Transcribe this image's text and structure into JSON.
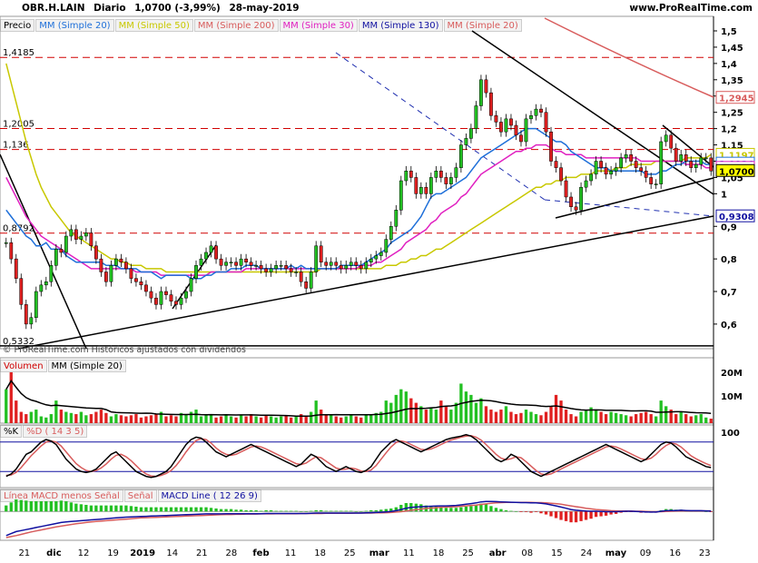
{
  "header": {
    "symbol": "OBR.H.LAIN",
    "period": "Diario",
    "last": "1,0700 (-3,99%)",
    "date": "28-may-2019",
    "site": "www.ProRealTime.com"
  },
  "price_legend": [
    {
      "label": "Precio",
      "color": "#000000"
    },
    {
      "label": "MM (Simple 20)",
      "color": "#1e6fd9"
    },
    {
      "label": "MM (Simple 50)",
      "color": "#c8c800"
    },
    {
      "label": "MM (Simple 200)",
      "color": "#d85c5c"
    },
    {
      "label": "MM (Simple 30)",
      "color": "#e020c0"
    },
    {
      "label": "MM (Simple 130)",
      "color": "#1010a0"
    },
    {
      "label": "MM (Simple 20)",
      "color": "#d85c5c"
    }
  ],
  "copyright": "© ProRealTime.com Históricos ajustados con dividendos",
  "volume_legend": [
    {
      "label": "Volumen",
      "color": "#d00000"
    },
    {
      "label": "MM (Simple 20)",
      "color": "#000000"
    }
  ],
  "stoch_legend": [
    {
      "label": "%K",
      "color": "#000000"
    },
    {
      "label": "%D ( 14 3 5)",
      "color": "#d85c5c"
    }
  ],
  "macd_legend": [
    {
      "label": "Línea MACD menos Señal",
      "color": "#d85c5c"
    },
    {
      "label": "Señal",
      "color": "#d85c5c"
    },
    {
      "label": "MACD Line ( 12 26 9)",
      "color": "#1010a0"
    }
  ],
  "hlines": [
    {
      "label": "1,4185",
      "value": 1.4185
    },
    {
      "label": "1,2005",
      "value": 1.2005
    },
    {
      "label": "1,136",
      "value": 1.136
    },
    {
      "label": "0,8792",
      "value": 0.8792
    },
    {
      "label": "0,5332",
      "value": 0.5332
    }
  ],
  "chart_data": {
    "type": "candlestick",
    "y_axis": {
      "min": 0.53,
      "max": 1.5,
      "ticks": [
        "1,5",
        "1,45",
        "1,4",
        "1,35",
        "1,3",
        "1,25",
        "1,2",
        "1,15",
        "1,1",
        "1,05",
        "1",
        "0,9",
        "0,8",
        "0,7",
        "0,6"
      ],
      "tick_values": [
        1.5,
        1.45,
        1.4,
        1.35,
        1.3,
        1.25,
        1.2,
        1.15,
        1.1,
        1.05,
        1.0,
        0.9,
        0.8,
        0.7,
        0.6
      ]
    },
    "x_labels": [
      "21",
      "dic",
      "12",
      "19",
      "2019",
      "14",
      "21",
      "28",
      "feb",
      "11",
      "18",
      "25",
      "mar",
      "11",
      "18",
      "25",
      "abr",
      "08",
      "15",
      "24",
      "may",
      "09",
      "16",
      "23"
    ],
    "value_tags": [
      {
        "label": "1,2945",
        "value": 1.2945,
        "color": "#d85c5c"
      },
      {
        "label": "1,1197",
        "value": 1.1197,
        "color": "#c8c800"
      },
      {
        "label": "1,0926",
        "value": 1.0926,
        "color": "#1e6fd9"
      },
      {
        "label": "1,0796",
        "value": 1.0796,
        "color": "#e020c0"
      },
      {
        "label": "1,0700",
        "value": 1.07,
        "color": "#000000"
      },
      {
        "label": "0,9308",
        "value": 0.9308,
        "color": "#1010a0"
      }
    ],
    "close": [
      0.85,
      0.8,
      0.74,
      0.66,
      0.6,
      0.62,
      0.7,
      0.72,
      0.73,
      0.78,
      0.83,
      0.82,
      0.87,
      0.89,
      0.86,
      0.87,
      0.88,
      0.84,
      0.8,
      0.76,
      0.73,
      0.78,
      0.8,
      0.79,
      0.77,
      0.74,
      0.73,
      0.72,
      0.7,
      0.68,
      0.66,
      0.7,
      0.69,
      0.67,
      0.66,
      0.68,
      0.7,
      0.74,
      0.78,
      0.8,
      0.82,
      0.84,
      0.8,
      0.78,
      0.79,
      0.79,
      0.78,
      0.8,
      0.79,
      0.78,
      0.78,
      0.77,
      0.76,
      0.77,
      0.78,
      0.78,
      0.77,
      0.76,
      0.76,
      0.73,
      0.71,
      0.76,
      0.84,
      0.79,
      0.78,
      0.79,
      0.78,
      0.77,
      0.78,
      0.79,
      0.78,
      0.77,
      0.79,
      0.8,
      0.81,
      0.82,
      0.86,
      0.9,
      0.95,
      1.04,
      1.07,
      1.05,
      1.0,
      1.02,
      1.0,
      1.05,
      1.07,
      1.05,
      1.03,
      1.05,
      1.08,
      1.15,
      1.17,
      1.2,
      1.27,
      1.35,
      1.31,
      1.24,
      1.22,
      1.19,
      1.23,
      1.21,
      1.18,
      1.16,
      1.23,
      1.24,
      1.26,
      1.25,
      1.19,
      1.1,
      1.08,
      1.04,
      0.99,
      0.96,
      0.95,
      1.02,
      1.04,
      1.06,
      1.1,
      1.08,
      1.06,
      1.07,
      1.08,
      1.11,
      1.12,
      1.1,
      1.08,
      1.07,
      1.05,
      1.03,
      1.03,
      1.16,
      1.18,
      1.14,
      1.1,
      1.12,
      1.1,
      1.08,
      1.09,
      1.11,
      1.11,
      1.07
    ],
    "sma20": [
      0.95,
      0.93,
      0.91,
      0.89,
      0.87,
      0.86,
      0.84,
      0.84,
      0.85,
      0.83,
      0.83,
      0.83,
      0.81,
      0.8,
      0.79,
      0.79,
      0.79,
      0.79,
      0.79,
      0.79,
      0.78,
      0.78,
      0.78,
      0.77,
      0.77,
      0.77,
      0.77,
      0.76,
      0.76,
      0.76,
      0.75,
      0.74,
      0.75,
      0.75,
      0.75,
      0.75,
      0.75,
      0.74,
      0.74,
      0.74,
      0.75,
      0.75,
      0.76,
      0.76,
      0.76,
      0.77,
      0.77,
      0.77,
      0.78,
      0.78,
      0.78,
      0.77,
      0.77,
      0.77,
      0.77,
      0.77,
      0.77,
      0.78,
      0.77,
      0.78,
      0.77,
      0.77,
      0.77,
      0.77,
      0.77,
      0.77,
      0.77,
      0.78,
      0.78,
      0.78,
      0.78,
      0.78,
      0.79,
      0.8,
      0.81,
      0.82,
      0.83,
      0.85,
      0.86,
      0.87,
      0.88,
      0.89,
      0.91,
      0.93,
      0.96,
      0.99,
      1.0,
      1.0,
      1.01,
      1.02,
      1.03,
      1.04,
      1.05,
      1.07,
      1.09,
      1.11,
      1.12,
      1.13,
      1.14,
      1.15,
      1.16,
      1.17,
      1.18,
      1.19,
      1.2,
      1.2,
      1.2,
      1.19,
      1.18,
      1.17,
      1.16,
      1.16,
      1.15,
      1.13,
      1.12,
      1.11,
      1.1,
      1.09,
      1.08,
      1.08,
      1.08,
      1.07,
      1.07,
      1.07,
      1.07,
      1.07,
      1.07,
      1.07,
      1.06,
      1.06,
      1.06,
      1.07,
      1.07,
      1.08,
      1.09,
      1.09,
      1.1,
      1.1,
      1.1,
      1.1,
      1.09,
      1.09
    ],
    "sma30": [
      1.05,
      1.02,
      0.99,
      0.96,
      0.93,
      0.91,
      0.89,
      0.87,
      0.86,
      0.85,
      0.84,
      0.83,
      0.82,
      0.81,
      0.8,
      0.79,
      0.78,
      0.77,
      0.77,
      0.77,
      0.77,
      0.77,
      0.77,
      0.77,
      0.77,
      0.77,
      0.76,
      0.76,
      0.76,
      0.76,
      0.76,
      0.75,
      0.75,
      0.75,
      0.75,
      0.75,
      0.75,
      0.75,
      0.75,
      0.75,
      0.75,
      0.76,
      0.76,
      0.76,
      0.76,
      0.76,
      0.76,
      0.76,
      0.77,
      0.77,
      0.77,
      0.77,
      0.77,
      0.77,
      0.77,
      0.77,
      0.77,
      0.77,
      0.77,
      0.77,
      0.77,
      0.77,
      0.77,
      0.77,
      0.77,
      0.77,
      0.77,
      0.77,
      0.77,
      0.77,
      0.77,
      0.78,
      0.78,
      0.78,
      0.79,
      0.79,
      0.8,
      0.81,
      0.82,
      0.83,
      0.85,
      0.86,
      0.87,
      0.88,
      0.89,
      0.91,
      0.92,
      0.94,
      0.95,
      0.96,
      0.97,
      0.99,
      1.0,
      1.02,
      1.04,
      1.06,
      1.07,
      1.08,
      1.09,
      1.1,
      1.11,
      1.12,
      1.13,
      1.13,
      1.14,
      1.14,
      1.15,
      1.15,
      1.15,
      1.14,
      1.13,
      1.13,
      1.12,
      1.12,
      1.12,
      1.12,
      1.11,
      1.11,
      1.11,
      1.11,
      1.11,
      1.11,
      1.11,
      1.11,
      1.11,
      1.11,
      1.11,
      1.1,
      1.1,
      1.1,
      1.1,
      1.1,
      1.1,
      1.1,
      1.1,
      1.1,
      1.09,
      1.09,
      1.09,
      1.09,
      1.08,
      1.08
    ],
    "sma50": [
      1.4,
      1.34,
      1.28,
      1.22,
      1.16,
      1.11,
      1.06,
      1.02,
      0.99,
      0.96,
      0.94,
      0.92,
      0.9,
      0.88,
      0.87,
      0.86,
      0.85,
      0.84,
      0.83,
      0.82,
      0.81,
      0.8,
      0.8,
      0.79,
      0.79,
      0.78,
      0.78,
      0.78,
      0.77,
      0.77,
      0.77,
      0.77,
      0.76,
      0.76,
      0.76,
      0.76,
      0.76,
      0.76,
      0.76,
      0.76,
      0.76,
      0.76,
      0.76,
      0.76,
      0.76,
      0.76,
      0.76,
      0.76,
      0.76,
      0.76,
      0.76,
      0.76,
      0.76,
      0.76,
      0.76,
      0.76,
      0.76,
      0.76,
      0.76,
      0.76,
      0.76,
      0.76,
      0.76,
      0.77,
      0.77,
      0.77,
      0.77,
      0.77,
      0.77,
      0.77,
      0.77,
      0.77,
      0.77,
      0.77,
      0.77,
      0.77,
      0.78,
      0.78,
      0.78,
      0.79,
      0.79,
      0.8,
      0.8,
      0.81,
      0.81,
      0.82,
      0.83,
      0.83,
      0.84,
      0.85,
      0.86,
      0.87,
      0.88,
      0.89,
      0.9,
      0.91,
      0.92,
      0.93,
      0.94,
      0.95,
      0.96,
      0.97,
      0.98,
      0.99,
      1.0,
      1.01,
      1.02,
      1.02,
      1.03,
      1.03,
      1.04,
      1.04,
      1.05,
      1.05,
      1.05,
      1.06,
      1.06,
      1.06,
      1.07,
      1.07,
      1.07,
      1.07,
      1.08,
      1.08,
      1.08,
      1.09,
      1.09,
      1.09,
      1.09,
      1.09,
      1.1,
      1.1,
      1.1,
      1.1,
      1.1,
      1.1,
      1.11,
      1.11,
      1.11,
      1.11,
      1.11,
      1.12
    ],
    "volume": [
      30,
      45,
      20,
      10,
      8,
      10,
      12,
      6,
      5,
      8,
      20,
      12,
      10,
      9,
      8,
      10,
      7,
      8,
      10,
      12,
      9,
      6,
      8,
      7,
      6,
      7,
      8,
      5,
      6,
      7,
      8,
      10,
      6,
      7,
      6,
      9,
      8,
      10,
      12,
      6,
      8,
      7,
      5,
      6,
      7,
      6,
      5,
      7,
      6,
      8,
      6,
      5,
      7,
      6,
      5,
      6,
      7,
      5,
      6,
      8,
      6,
      10,
      20,
      12,
      8,
      7,
      6,
      5,
      6,
      7,
      6,
      5,
      8,
      7,
      9,
      10,
      20,
      18,
      25,
      30,
      28,
      22,
      18,
      15,
      12,
      14,
      12,
      20,
      15,
      12,
      18,
      35,
      28,
      25,
      18,
      22,
      15,
      12,
      10,
      12,
      15,
      10,
      8,
      9,
      12,
      10,
      8,
      7,
      10,
      15,
      25,
      20,
      12,
      8,
      6,
      10,
      12,
      14,
      12,
      10,
      8,
      10,
      9,
      8,
      7,
      6,
      8,
      9,
      10,
      8,
      6,
      20,
      15,
      12,
      8,
      10,
      8,
      6,
      7,
      8,
      5,
      4
    ],
    "stoch_k": [
      10,
      15,
      25,
      40,
      55,
      60,
      70,
      80,
      85,
      82,
      75,
      60,
      45,
      35,
      25,
      20,
      18,
      20,
      25,
      35,
      45,
      55,
      60,
      50,
      40,
      30,
      20,
      15,
      10,
      8,
      10,
      15,
      20,
      30,
      45,
      60,
      75,
      85,
      90,
      88,
      80,
      70,
      60,
      55,
      50,
      55,
      60,
      65,
      70,
      75,
      70,
      65,
      60,
      55,
      50,
      45,
      40,
      35,
      30,
      35,
      45,
      55,
      50,
      40,
      30,
      25,
      20,
      25,
      30,
      25,
      20,
      18,
      22,
      30,
      45,
      60,
      70,
      80,
      85,
      80,
      75,
      70,
      65,
      60,
      65,
      70,
      75,
      80,
      85,
      88,
      90,
      92,
      95,
      92,
      85,
      75,
      65,
      55,
      45,
      40,
      45,
      55,
      50,
      40,
      30,
      20,
      15,
      10,
      15,
      20,
      25,
      30,
      35,
      40,
      45,
      50,
      55,
      60,
      65,
      70,
      75,
      70,
      65,
      60,
      55,
      50,
      45,
      40,
      45,
      55,
      65,
      75,
      80,
      78,
      70,
      60,
      50,
      45,
      40,
      35,
      30,
      28
    ],
    "stoch_d": [
      12,
      13,
      18,
      28,
      40,
      52,
      62,
      72,
      80,
      82,
      80,
      72,
      60,
      48,
      36,
      28,
      22,
      20,
      22,
      27,
      35,
      45,
      53,
      55,
      50,
      42,
      32,
      22,
      15,
      11,
      10,
      12,
      16,
      22,
      32,
      45,
      60,
      73,
      83,
      87,
      85,
      78,
      68,
      60,
      55,
      53,
      55,
      60,
      65,
      70,
      72,
      70,
      66,
      61,
      56,
      51,
      46,
      41,
      36,
      34,
      37,
      44,
      50,
      48,
      41,
      34,
      27,
      24,
      25,
      27,
      25,
      21,
      20,
      23,
      32,
      45,
      58,
      70,
      79,
      82,
      80,
      75,
      70,
      65,
      64,
      66,
      70,
      75,
      80,
      84,
      87,
      90,
      92,
      93,
      90,
      84,
      75,
      65,
      55,
      47,
      44,
      46,
      50,
      48,
      40,
      31,
      22,
      15,
      13,
      15,
      20,
      25,
      30,
      35,
      40,
      45,
      50,
      55,
      60,
      65,
      70,
      72,
      70,
      66,
      61,
      56,
      51,
      46,
      44,
      47,
      55,
      65,
      73,
      78,
      76,
      70,
      61,
      52,
      46,
      41,
      36,
      32
    ],
    "macd": [
      -0.12,
      -0.11,
      -0.1,
      -0.095,
      -0.09,
      -0.085,
      -0.08,
      -0.075,
      -0.07,
      -0.065,
      -0.06,
      -0.055,
      -0.052,
      -0.05,
      -0.048,
      -0.046,
      -0.044,
      -0.042,
      -0.04,
      -0.038,
      -0.036,
      -0.034,
      -0.032,
      -0.03,
      -0.028,
      -0.027,
      -0.026,
      -0.025,
      -0.024,
      -0.023,
      -0.022,
      -0.021,
      -0.02,
      -0.019,
      -0.018,
      -0.017,
      -0.016,
      -0.015,
      -0.014,
      -0.013,
      -0.012,
      -0.012,
      -0.012,
      -0.012,
      -0.011,
      -0.011,
      -0.011,
      -0.011,
      -0.011,
      -0.011,
      -0.011,
      -0.011,
      -0.01,
      -0.01,
      -0.01,
      -0.01,
      -0.01,
      -0.01,
      -0.01,
      -0.01,
      -0.01,
      -0.009,
      -0.008,
      -0.008,
      -0.008,
      -0.008,
      -0.008,
      -0.008,
      -0.008,
      -0.008,
      -0.008,
      -0.008,
      -0.007,
      -0.006,
      -0.005,
      -0.004,
      -0.002,
      0.0,
      0.004,
      0.01,
      0.016,
      0.02,
      0.022,
      0.024,
      0.025,
      0.026,
      0.027,
      0.028,
      0.028,
      0.029,
      0.03,
      0.033,
      0.036,
      0.039,
      0.043,
      0.048,
      0.05,
      0.05,
      0.049,
      0.048,
      0.047,
      0.046,
      0.045,
      0.044,
      0.044,
      0.043,
      0.043,
      0.041,
      0.038,
      0.033,
      0.028,
      0.022,
      0.016,
      0.01,
      0.006,
      0.004,
      0.002,
      0.001,
      0.001,
      0.0,
      -0.001,
      -0.001,
      -0.001,
      0.0,
      0.001,
      0.001,
      0.0,
      -0.001,
      -0.002,
      -0.003,
      -0.003,
      0.001,
      0.004,
      0.005,
      0.005,
      0.006,
      0.005,
      0.004,
      0.004,
      0.004,
      0.003,
      0.002
    ],
    "signal": [
      -0.13,
      -0.125,
      -0.12,
      -0.114,
      -0.108,
      -0.102,
      -0.097,
      -0.092,
      -0.087,
      -0.082,
      -0.077,
      -0.073,
      -0.069,
      -0.065,
      -0.061,
      -0.058,
      -0.055,
      -0.052,
      -0.05,
      -0.048,
      -0.046,
      -0.044,
      -0.042,
      -0.04,
      -0.038,
      -0.036,
      -0.034,
      -0.032,
      -0.031,
      -0.03,
      -0.029,
      -0.028,
      -0.027,
      -0.026,
      -0.025,
      -0.024,
      -0.023,
      -0.022,
      -0.021,
      -0.02,
      -0.019,
      -0.018,
      -0.017,
      -0.016,
      -0.015,
      -0.015,
      -0.014,
      -0.014,
      -0.013,
      -0.013,
      -0.013,
      -0.012,
      -0.012,
      -0.012,
      -0.011,
      -0.011,
      -0.011,
      -0.011,
      -0.011,
      -0.01,
      -0.01,
      -0.01,
      -0.01,
      -0.01,
      -0.009,
      -0.009,
      -0.009,
      -0.009,
      -0.009,
      -0.009,
      -0.008,
      -0.008,
      -0.008,
      -0.008,
      -0.007,
      -0.007,
      -0.006,
      -0.005,
      -0.003,
      -0.001,
      0.002,
      0.006,
      0.009,
      0.012,
      0.015,
      0.017,
      0.019,
      0.021,
      0.022,
      0.023,
      0.024,
      0.026,
      0.028,
      0.03,
      0.032,
      0.035,
      0.038,
      0.041,
      0.043,
      0.044,
      0.045,
      0.045,
      0.045,
      0.045,
      0.045,
      0.045,
      0.044,
      0.044,
      0.043,
      0.041,
      0.039,
      0.036,
      0.032,
      0.028,
      0.024,
      0.02,
      0.016,
      0.013,
      0.01,
      0.008,
      0.006,
      0.004,
      0.003,
      0.002,
      0.002,
      0.002,
      0.001,
      0.001,
      0.0,
      -0.001,
      -0.001,
      -0.001,
      0.0,
      0.001,
      0.002,
      0.003,
      0.003,
      0.003,
      0.003,
      0.003,
      0.003,
      0.003
    ]
  }
}
